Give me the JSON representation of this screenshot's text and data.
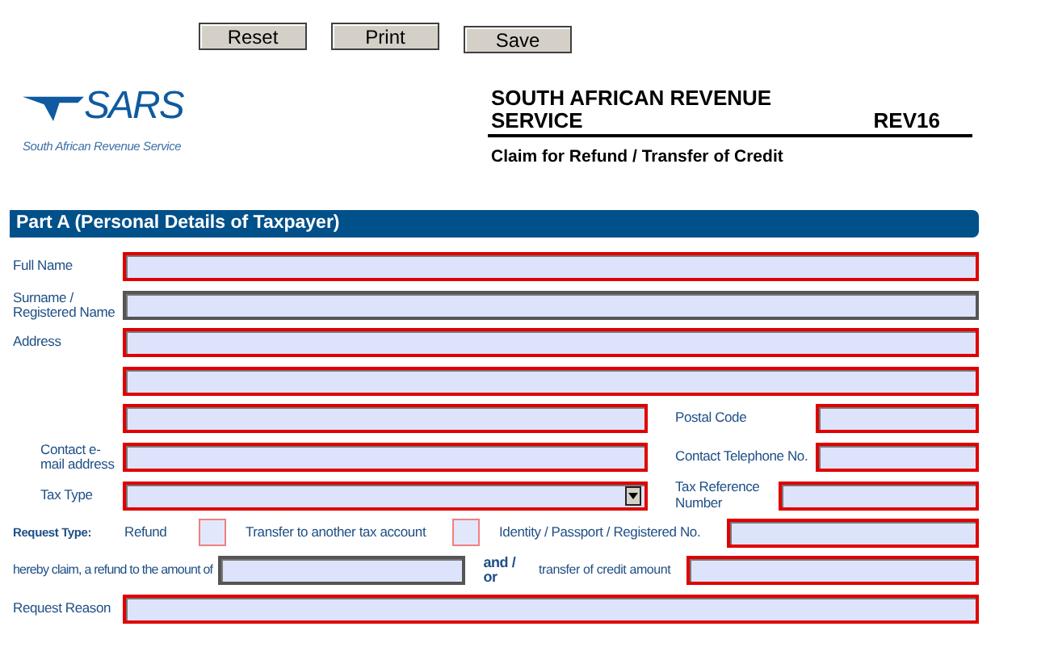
{
  "toolbar": {
    "buttons": [
      "Reset",
      "Print",
      "Save"
    ]
  },
  "logo": {
    "wordmark": "SARS",
    "tagline": "South African Revenue Service"
  },
  "header": {
    "title": "SOUTH AFRICAN REVENUE SERVICE",
    "code": "REV16",
    "subtitle": "Claim for Refund / Transfer of Credit"
  },
  "section": {
    "title": "Part A (Personal Details of Taxpayer)"
  },
  "rows": [
    {
      "kind": "wide",
      "cells": [
        {
          "kind": "label",
          "text": "Full Name"
        },
        {
          "kind": "field",
          "required": true
        }
      ]
    },
    {
      "kind": "wide",
      "cells": [
        {
          "kind": "label",
          "text": "Surname / Registered Name"
        },
        {
          "kind": "field",
          "required": false
        }
      ]
    },
    {
      "kind": "wide",
      "cells": [
        {
          "kind": "label",
          "text": "Address"
        },
        {
          "kind": "field",
          "required": true
        }
      ]
    },
    {
      "kind": "wide",
      "cells": [
        {
          "kind": "spacer"
        },
        {
          "kind": "field",
          "required": true
        }
      ]
    },
    {
      "kind": "pair",
      "cells": [
        {
          "kind": "spacer"
        },
        {
          "kind": "field",
          "required": true
        },
        {
          "kind": "label",
          "text": "Postal Code"
        },
        {
          "kind": "field",
          "required": true
        }
      ]
    },
    {
      "kind": "pair",
      "cells": [
        {
          "kind": "label",
          "text": "Contact e-mail address"
        },
        {
          "kind": "field",
          "required": true
        },
        {
          "kind": "label",
          "text": "Contact Telephone No."
        },
        {
          "kind": "field",
          "required": true
        }
      ]
    },
    {
      "kind": "taxpair",
      "cells": [
        {
          "kind": "label",
          "text": "Tax Type"
        },
        {
          "kind": "dropdown",
          "required": true
        },
        {
          "kind": "label",
          "text": "Tax Reference Number"
        },
        {
          "kind": "field",
          "required": true
        }
      ]
    },
    {
      "kind": "request",
      "cells": [
        {
          "kind": "small-label",
          "text": "Request Type:"
        },
        {
          "kind": "label",
          "text": "Refund"
        },
        {
          "kind": "checkbox",
          "checked": false
        },
        {
          "kind": "label",
          "text": "Transfer to another tax account"
        },
        {
          "kind": "checkbox",
          "checked": false
        },
        {
          "kind": "label",
          "text": "Identity / Passport / Registered No."
        },
        {
          "kind": "field",
          "required": true
        }
      ]
    },
    {
      "kind": "claim",
      "cells": [
        {
          "kind": "label",
          "text": "hereby claim, a refund to the amount of"
        },
        {
          "kind": "field",
          "required": false
        },
        {
          "kind": "strong-label",
          "text": "and / or"
        },
        {
          "kind": "label",
          "text": "transfer of credit amount"
        },
        {
          "kind": "field",
          "required": true
        }
      ]
    },
    {
      "kind": "wide",
      "cells": [
        {
          "kind": "label",
          "text": "Request Reason"
        },
        {
          "kind": "field",
          "required": true
        }
      ]
    }
  ]
}
